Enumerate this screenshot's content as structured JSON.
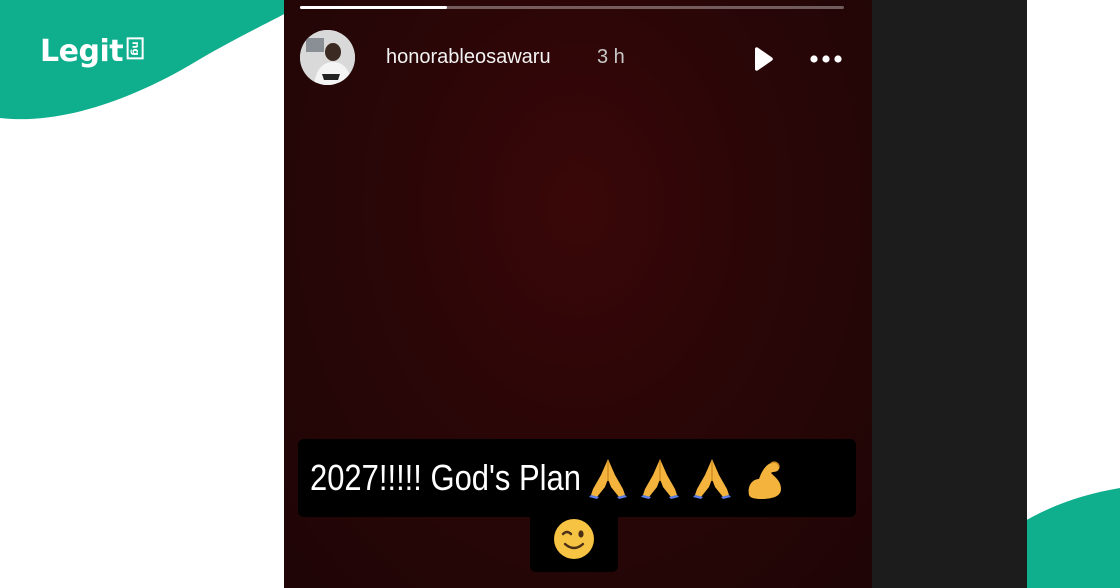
{
  "brand": {
    "logo_text": "Legit",
    "logo_suffix": "ng",
    "accent_color": "#0fae8d"
  },
  "story": {
    "progress": 0.27,
    "username": "honorableosawaru",
    "timestamp": "3 h",
    "caption": "2027!!!!! God's Plan",
    "caption_emojis": [
      "folded-hands-emoji",
      "folded-hands-emoji",
      "folded-hands-emoji",
      "flexed-biceps-emoji"
    ],
    "caption_emoji_line2": "winking-face-emoji",
    "icons": {
      "play": "play-icon",
      "more": "more-options-icon",
      "avatar": "avatar-photo"
    }
  }
}
